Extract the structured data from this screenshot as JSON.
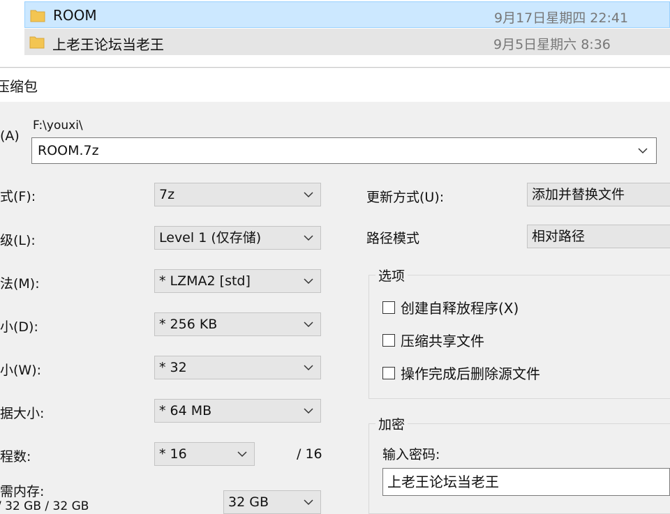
{
  "explorer": {
    "files": [
      {
        "name": "ROOM",
        "date": "9月17日星期四 22:41",
        "icon": "folder-icon"
      },
      {
        "name": "上老王论坛当老王",
        "date": "9月5日星期六 8:36",
        "icon": "folder-icon"
      }
    ]
  },
  "dialog": {
    "title": "压缩包",
    "archive": {
      "label": "(A)",
      "path": "F:\\youxi\\",
      "value": "ROOM.7z"
    },
    "left_fields": [
      {
        "label": "式(F):",
        "value": "7z"
      },
      {
        "label": "级(L):",
        "value": "Level 1 (仅存储)"
      },
      {
        "label": "法(M):",
        "value": "*  LZMA2 [std]"
      },
      {
        "label": "小(D):",
        "value": "*  256 KB"
      },
      {
        "label": "小(W):",
        "value": "*  32"
      },
      {
        "label": "据大小:",
        "value": "*  64 MB"
      },
      {
        "label": "程数:",
        "value": "*  16",
        "suffix": "/ 16"
      }
    ],
    "memory": {
      "label": "需内存:",
      "sub": "/ 32 GB / 32 GB",
      "value": "32 GB"
    },
    "update_mode": {
      "label": "更新方式(U):",
      "value": "添加并替换文件"
    },
    "path_mode": {
      "label": "路径模式",
      "value": "相对路径"
    },
    "options": {
      "title": "选项",
      "items": [
        {
          "label": "创建自释放程序(X)",
          "checked": false
        },
        {
          "label": "压缩共享文件",
          "checked": false
        },
        {
          "label": "操作完成后删除源文件",
          "checked": false
        }
      ]
    },
    "encryption": {
      "title": "加密",
      "password_label": "输入密码:",
      "password_value": "上老王论坛当老王"
    }
  },
  "colors": {
    "selected_row": "#cce8ff",
    "hover_row": "#e5e5e5",
    "folder": "#f3c552",
    "dialog_bg": "#f0f0f0"
  }
}
